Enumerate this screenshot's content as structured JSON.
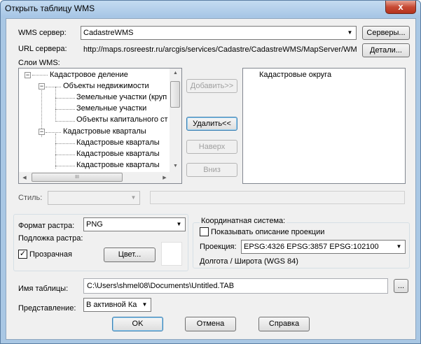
{
  "window": {
    "title": "Открыть таблицу WMS",
    "close_glyph": "x"
  },
  "server": {
    "label": "WMS сервер:",
    "value": "CadastreWMS",
    "servers_button": "Серверы...",
    "url_label": "URL сервера:",
    "url_value": "http://maps.rosreestr.ru/arcgis/services/Cadastre/CadastreWMS/MapServer/WM",
    "details_button": "Детали..."
  },
  "layers": {
    "label": "Слои WMS:",
    "tree": [
      {
        "text": "Кадастровое деление",
        "expander": "−"
      },
      {
        "text": "Объекты недвижимости",
        "expander": "−"
      },
      {
        "text": "Земельные участки (круп"
      },
      {
        "text": "Земельные участки"
      },
      {
        "text": "Объекты капитального ст"
      },
      {
        "text": "Кадастровые кварталы",
        "expander": "−"
      },
      {
        "text": "Кадастровые кварталы"
      },
      {
        "text": "Кадастровые кварталы"
      },
      {
        "text": "Кадастровые кварталы"
      }
    ],
    "selected": [
      "Кадастровые округа"
    ],
    "add_button": "Добавить>>",
    "remove_button": "Удалить<<",
    "up_button": "Наверх",
    "down_button": "Вниз",
    "scroll_up": "▲",
    "scroll_down": "▼",
    "scroll_left": "◀",
    "scroll_right": "▶",
    "thumb_grip": "III"
  },
  "style": {
    "label": "Стиль:",
    "value": ""
  },
  "raster": {
    "format_label": "Формат растра:",
    "format_value": "PNG",
    "underlay_label": "Подложка растра:",
    "transparent_label": "Прозрачная",
    "transparent_checked": true,
    "check_glyph": "✓",
    "color_button": "Цвет...",
    "swatch_color": "#ffffff"
  },
  "coords": {
    "group_label": "Координатная система:",
    "show_projection_label": "Показывать описание проекции",
    "show_projection_checked": false,
    "projection_label": "Проекция:",
    "projection_value": "EPSG:4326 EPSG:3857 EPSG:102100",
    "projection_desc": "Долгота / Широта (WGS 84)"
  },
  "table": {
    "name_label": "Имя таблицы:",
    "name_value": "C:\\Users\\shmel08\\Documents\\Untitled.TAB",
    "browse_button": "...",
    "view_label": "Представление:",
    "view_value": "В активной Ка"
  },
  "footer": {
    "ok": "OK",
    "cancel": "Отмена",
    "help": "Справка"
  },
  "icons": {
    "dropdown": "chevron-down-icon",
    "close": "close-icon",
    "check": "check-icon"
  },
  "colors": {
    "title_bar": "#a6c5e5",
    "close_button": "#c74a34",
    "dialog_bg": "#f0f0f0",
    "selection_highlight": "#3399ff"
  }
}
